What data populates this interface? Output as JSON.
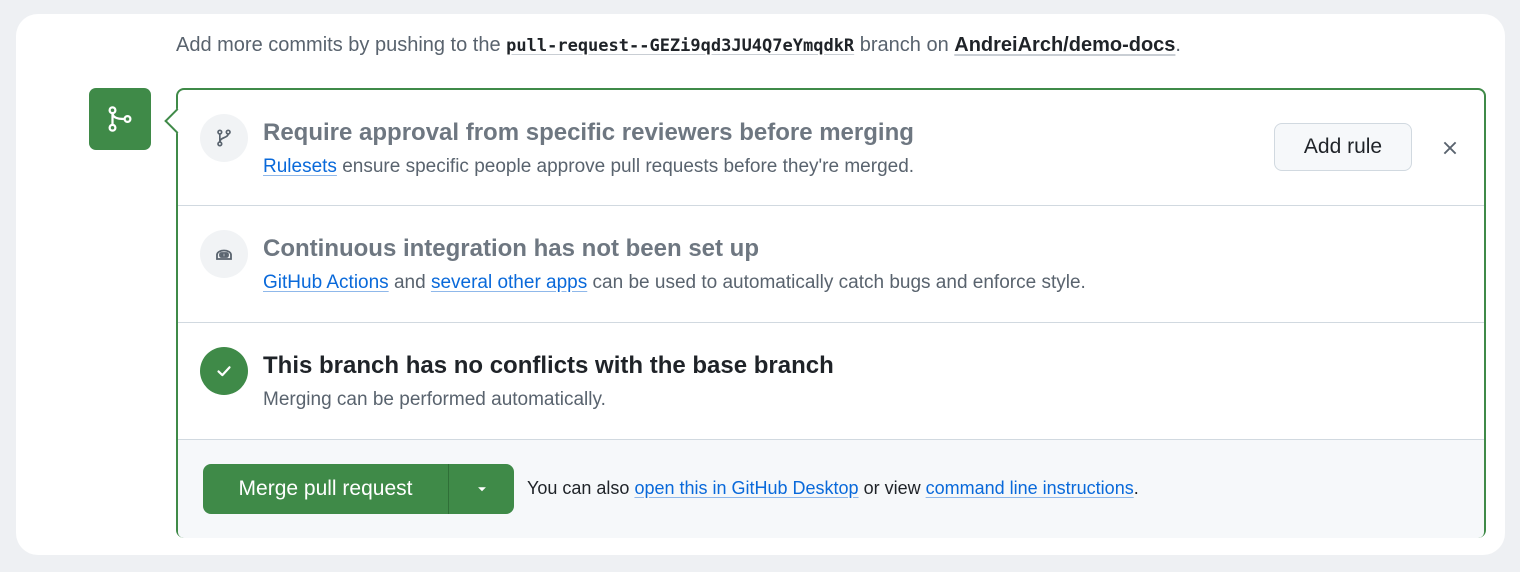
{
  "hint": {
    "prefix": "Add more commits by pushing to the",
    "branch": "pull-request--GEZi9qd3JU4Q7eYmqdkR",
    "middle": "branch on",
    "repo": "AndreiArch/demo-docs",
    "suffix": "."
  },
  "approval": {
    "icon": "git-branch-icon",
    "title": "Require approval from specific reviewers before merging",
    "link": "Rulesets",
    "text": "ensure specific people approve pull requests before they're merged.",
    "add_rule_label": "Add rule",
    "close_icon": "close-icon"
  },
  "ci": {
    "icon": "robot-icon",
    "title": "Continuous integration has not been set up",
    "link1": "GitHub Actions",
    "and_text": "and",
    "link2": "several other apps",
    "text": "can be used to automatically catch bugs and enforce style."
  },
  "conflicts": {
    "icon": "check-icon",
    "title": "This branch has no conflicts with the base branch",
    "text": "Merging can be performed automatically."
  },
  "merge": {
    "button_label": "Merge pull request",
    "caret_icon": "triangle-down-icon",
    "text_prefix": "You can also",
    "link1": "open this in GitHub Desktop",
    "text_middle": "or view",
    "link2": "command line instructions",
    "text_suffix": "."
  },
  "colors": {
    "success": "#3f8a48",
    "link": "#0969da",
    "muted": "#59636e"
  }
}
